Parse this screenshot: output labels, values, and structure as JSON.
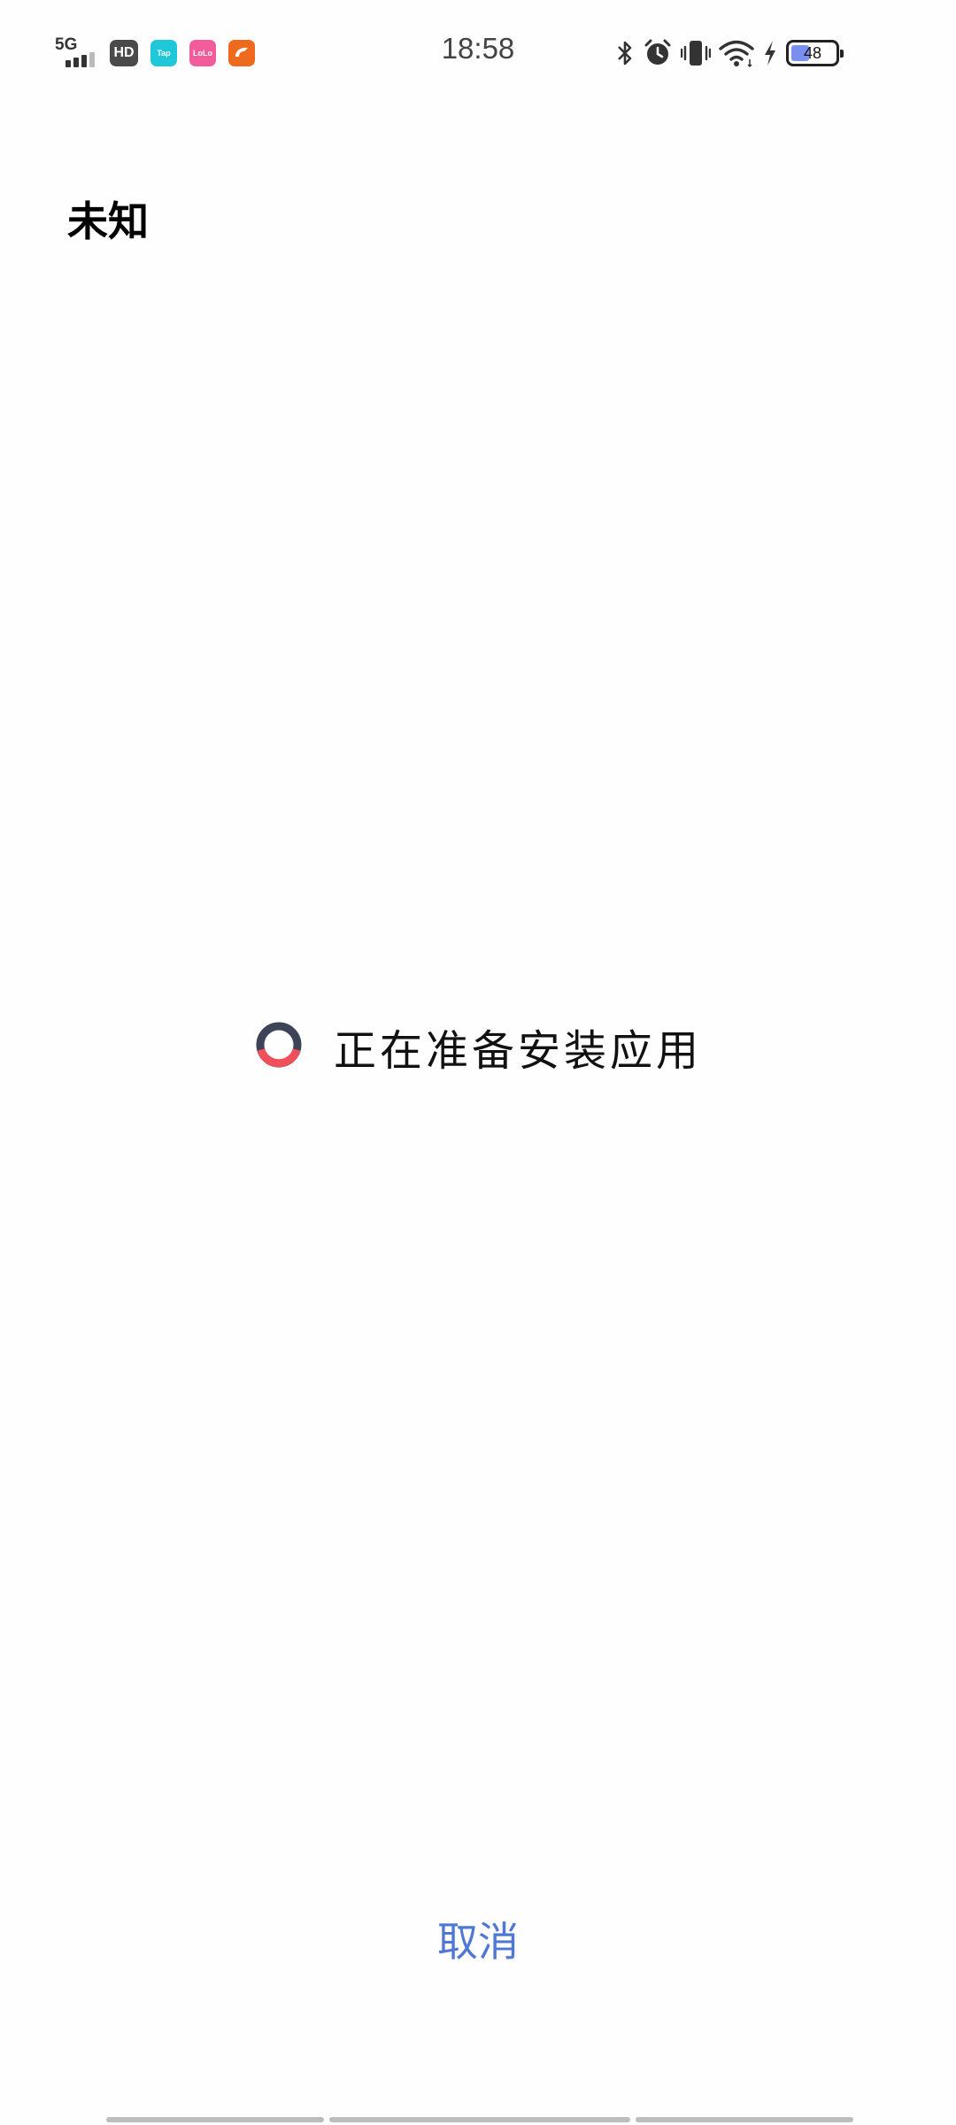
{
  "status_bar": {
    "network_type": "5G",
    "hd_label": "HD",
    "time": "18:58",
    "battery_level": "48",
    "notification_apps": [
      {
        "icon": "tap-app-icon",
        "color": "#1ec8d8",
        "label": "Tap"
      },
      {
        "icon": "lolo-app-icon",
        "color": "#f25c9a",
        "label": "LoLo"
      },
      {
        "icon": "orange-app-icon",
        "color": "#ee6a1f",
        "label": ""
      }
    ],
    "right_icons": [
      "bluetooth-icon",
      "alarm-icon",
      "vibrate-icon",
      "wifi-icon",
      "charging-icon",
      "battery-icon"
    ]
  },
  "header": {
    "app_name": "未知"
  },
  "install": {
    "status_text": "正在准备安装应用",
    "spinner_colors": {
      "track": "#3d4458",
      "arc": "#f0505a"
    }
  },
  "actions": {
    "cancel_label": "取消"
  },
  "colors": {
    "background": "#fefefe",
    "accent": "#4f77d6"
  }
}
